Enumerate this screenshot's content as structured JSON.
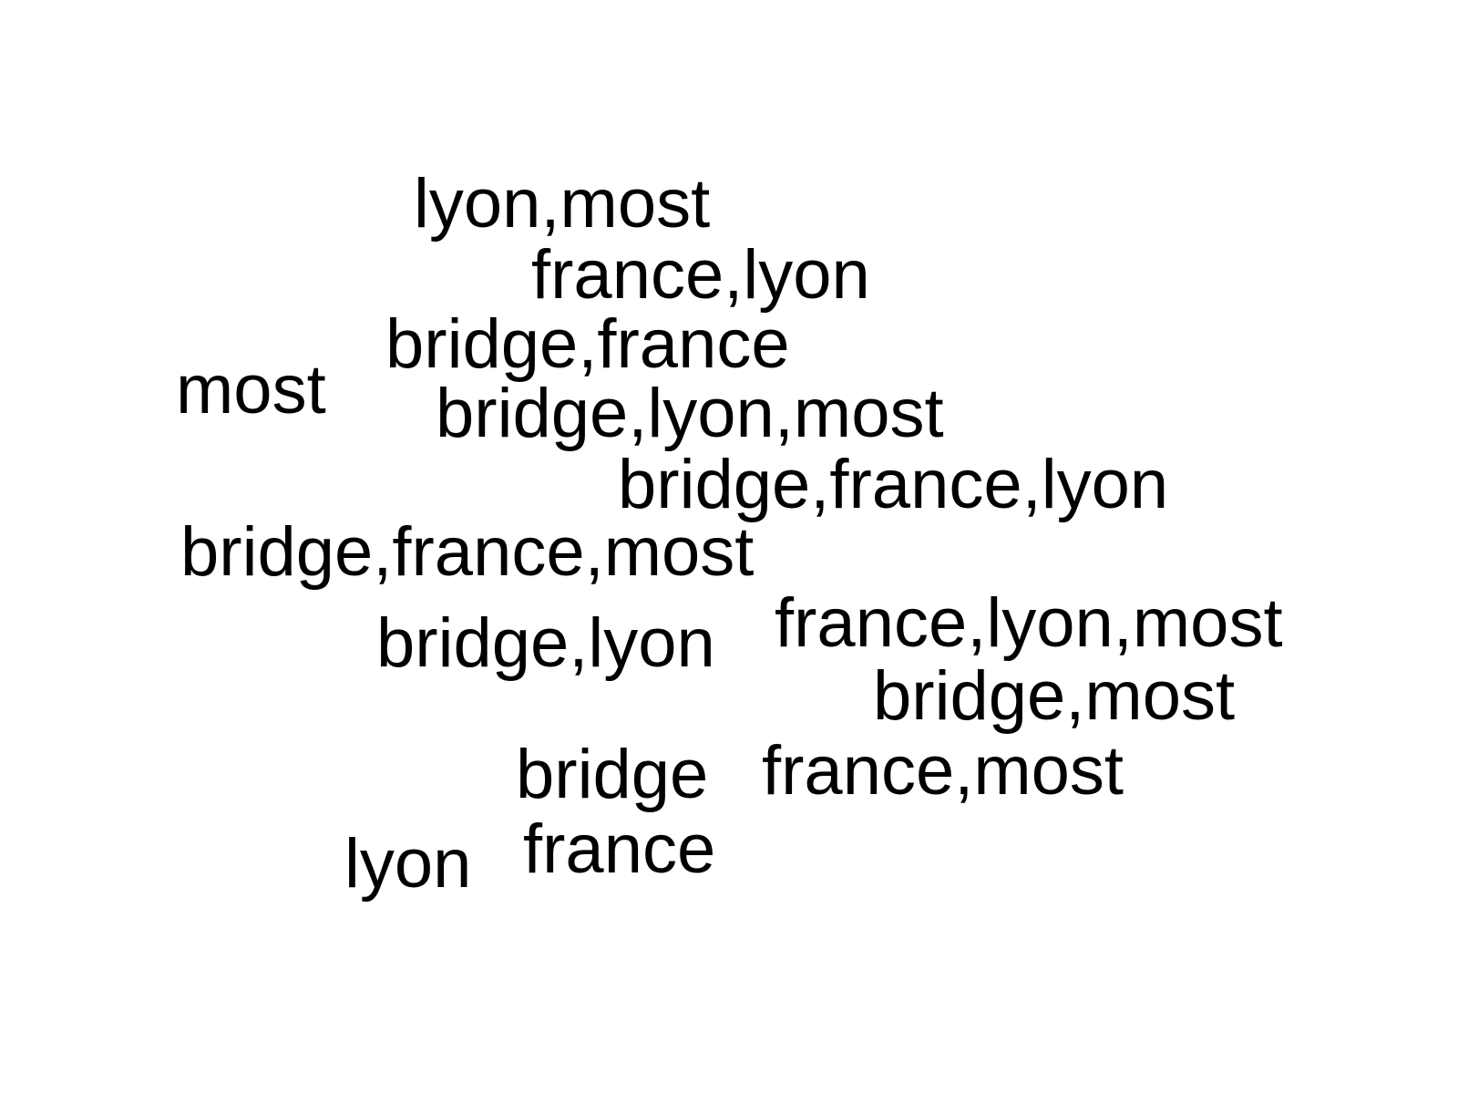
{
  "canvas": {
    "background_color": "#ffffff",
    "text_color": "#000000"
  },
  "terms": [
    {
      "id": "lyon-most",
      "text": "lyon,most"
    },
    {
      "id": "france-lyon",
      "text": "france,lyon"
    },
    {
      "id": "bridge-france",
      "text": "bridge,france"
    },
    {
      "id": "most",
      "text": "most"
    },
    {
      "id": "bridge-lyon-most",
      "text": "bridge,lyon,most"
    },
    {
      "id": "bridge-france-lyon",
      "text": "bridge,france,lyon"
    },
    {
      "id": "bridge-france-most",
      "text": "bridge,france,most"
    },
    {
      "id": "bridge-lyon",
      "text": "bridge,lyon"
    },
    {
      "id": "france-lyon-most",
      "text": "france,lyon,most"
    },
    {
      "id": "bridge-most",
      "text": "bridge,most"
    },
    {
      "id": "bridge",
      "text": "bridge"
    },
    {
      "id": "france-most",
      "text": "france,most"
    },
    {
      "id": "france",
      "text": "france"
    },
    {
      "id": "lyon",
      "text": "lyon"
    }
  ]
}
